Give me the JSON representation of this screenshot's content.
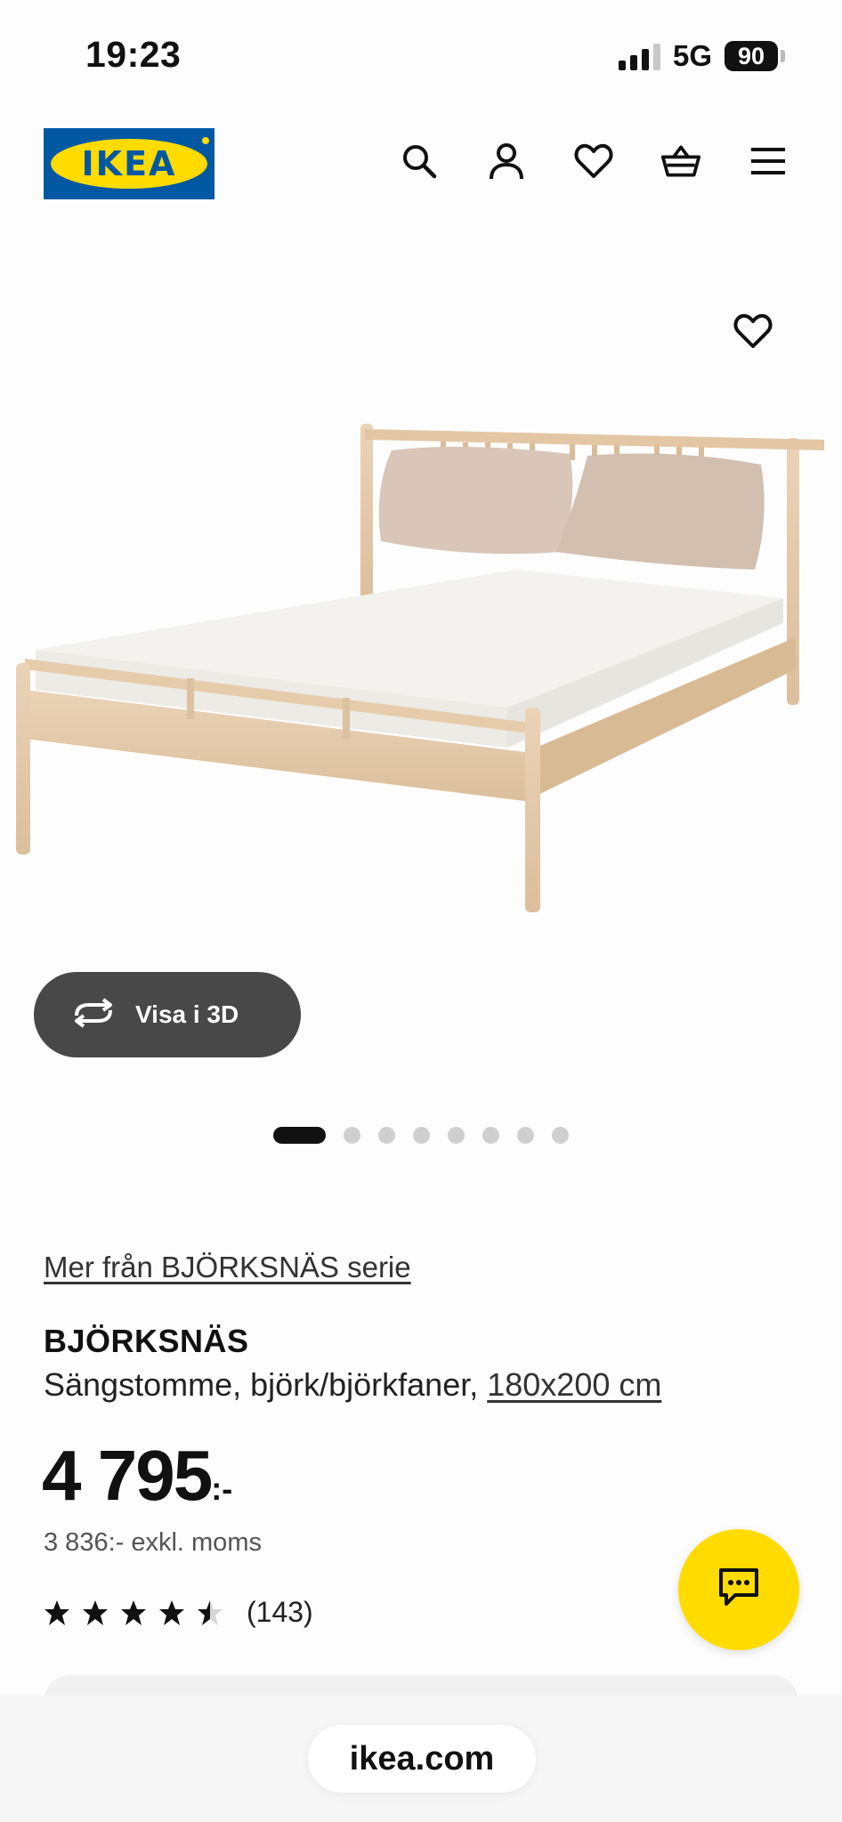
{
  "status_bar": {
    "time": "19:23",
    "network": "5G",
    "battery": "90"
  },
  "header": {
    "logo_text": "IKEA",
    "icons": [
      "search-icon",
      "account-icon",
      "heart-icon",
      "basket-icon",
      "menu-icon"
    ]
  },
  "gallery": {
    "view3d_label": "Visa i 3D",
    "active_index": 0,
    "total_images": 8
  },
  "product": {
    "series_link": "Mer från BJÖRKSNÄS serie",
    "name": "BJÖRKSNÄS",
    "description": "Sängstomme, björk/björkfaner, ",
    "size": "180x200 cm",
    "price": "4 795",
    "price_suffix": ":-",
    "price_excl": "3 836:- exkl. moms",
    "rating": 4.5,
    "rating_count": "(143)"
  },
  "browser": {
    "url": "ikea.com"
  },
  "colors": {
    "ikea_blue": "#0058a3",
    "ikea_yellow": "#ffdb00",
    "dark_button": "#484848"
  }
}
